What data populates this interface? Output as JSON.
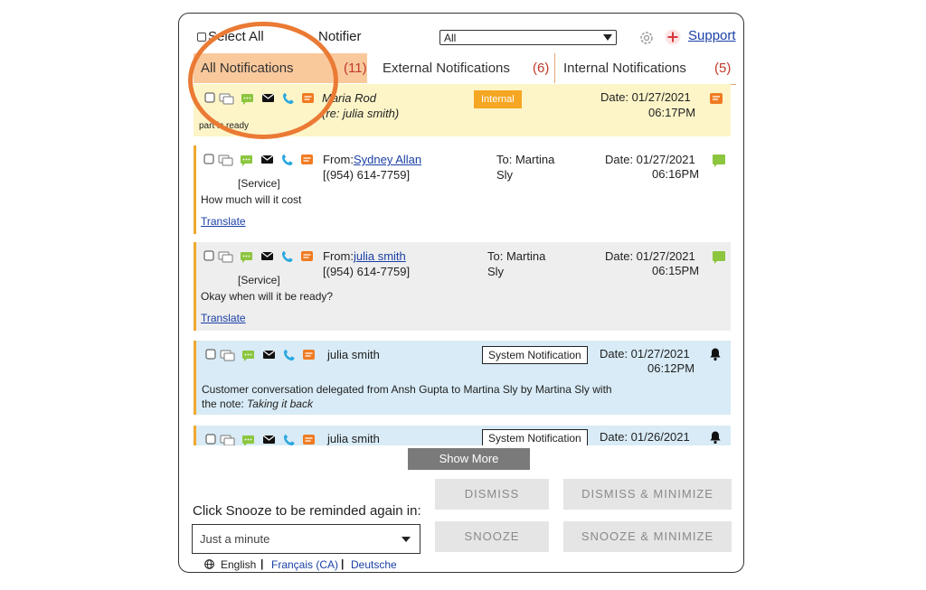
{
  "header": {
    "select_all": "Select All",
    "notifier": "Notifier",
    "filter_value": "All",
    "support": "Support"
  },
  "tabs": [
    {
      "label": "All Notifications",
      "count": "(11)"
    },
    {
      "label": "External Notifications",
      "count": "(6)"
    },
    {
      "label": "Internal Notifications",
      "count": "(5)"
    }
  ],
  "notifications": [
    {
      "name": "Maria Rod",
      "sub": "(re: julia smith)",
      "badge": "Internal",
      "date": "Date: 01/27/2021",
      "time": "06:17PM",
      "body": "part is ready"
    },
    {
      "from_prefix": "From:",
      "from": "Sydney Allan",
      "phone": "[(954) 614-7759]",
      "to": "To: Martina",
      "to2": "Sly",
      "date": "Date: 01/27/2021",
      "time": "06:16PM",
      "tag": "[Service]",
      "body": "How much will it cost",
      "translate": "Translate"
    },
    {
      "from_prefix": "From:",
      "from": "julia smith",
      "phone": "[(954) 614-7759]",
      "to": "To: Martina",
      "to2": "Sly",
      "date": "Date: 01/27/2021",
      "time": "06:15PM",
      "tag": "[Service]",
      "body": "Okay when will it be ready?",
      "translate": "Translate"
    },
    {
      "name": "julia smith",
      "badge": "System Notification",
      "date": "Date: 01/27/2021",
      "time": "06:12PM",
      "body_pre": "Customer conversation delegated from ",
      "body_a": "Ansh Gupta",
      "body_mid": " to ",
      "body_b": "Martina Sly",
      "body_by": " by ",
      "body_c": "Martina Sly",
      "body_post": " with",
      "body_line2": "the note: ",
      "body_note": "Taking it back"
    },
    {
      "name": "julia smith",
      "badge": "System Notification",
      "date": "Date: 01/26/2021"
    }
  ],
  "show_more": "Show More",
  "snooze": {
    "label": "Click Snooze to be reminded again in:",
    "value": "Just a minute"
  },
  "buttons": {
    "dismiss": "DISMISS",
    "dismiss_min": "DISMISS & MINIMIZE",
    "snooze": "SNOOZE",
    "snooze_min": "SNOOZE & MINIMIZE"
  },
  "languages": [
    "English",
    "Français (CA)",
    "Deutsche"
  ],
  "colors": {
    "accent": "#f0a830",
    "highlight_circle": "#ea7a34",
    "internal_badge": "#f5a623",
    "yellow_row": "#fdf5c8",
    "gray_row": "#eeeeee",
    "blue_row": "#d8ebf6",
    "link": "#1a3fa6"
  }
}
